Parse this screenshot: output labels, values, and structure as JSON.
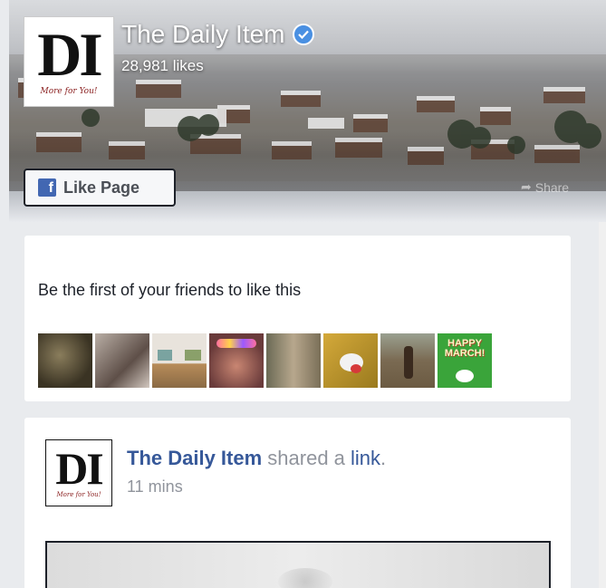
{
  "page": {
    "name": "The Daily Item",
    "likes": "28,981 likes",
    "logo_letters": "DI",
    "logo_tagline": "More for You!",
    "like_button_label": "Like Page",
    "share_label": "Share"
  },
  "friends": {
    "text": "Be the first of your friends to like this",
    "avatar_last_text": "HAPPY MARCH!"
  },
  "post": {
    "author": "The Daily Item",
    "action_text": "shared a",
    "link_text": "link",
    "link_suffix": ".",
    "time": "11 mins"
  },
  "colors": {
    "facebook_blue": "#4267b2",
    "link_blue": "#365899",
    "verified": "#4a90e2",
    "background": "#e9ebee"
  }
}
